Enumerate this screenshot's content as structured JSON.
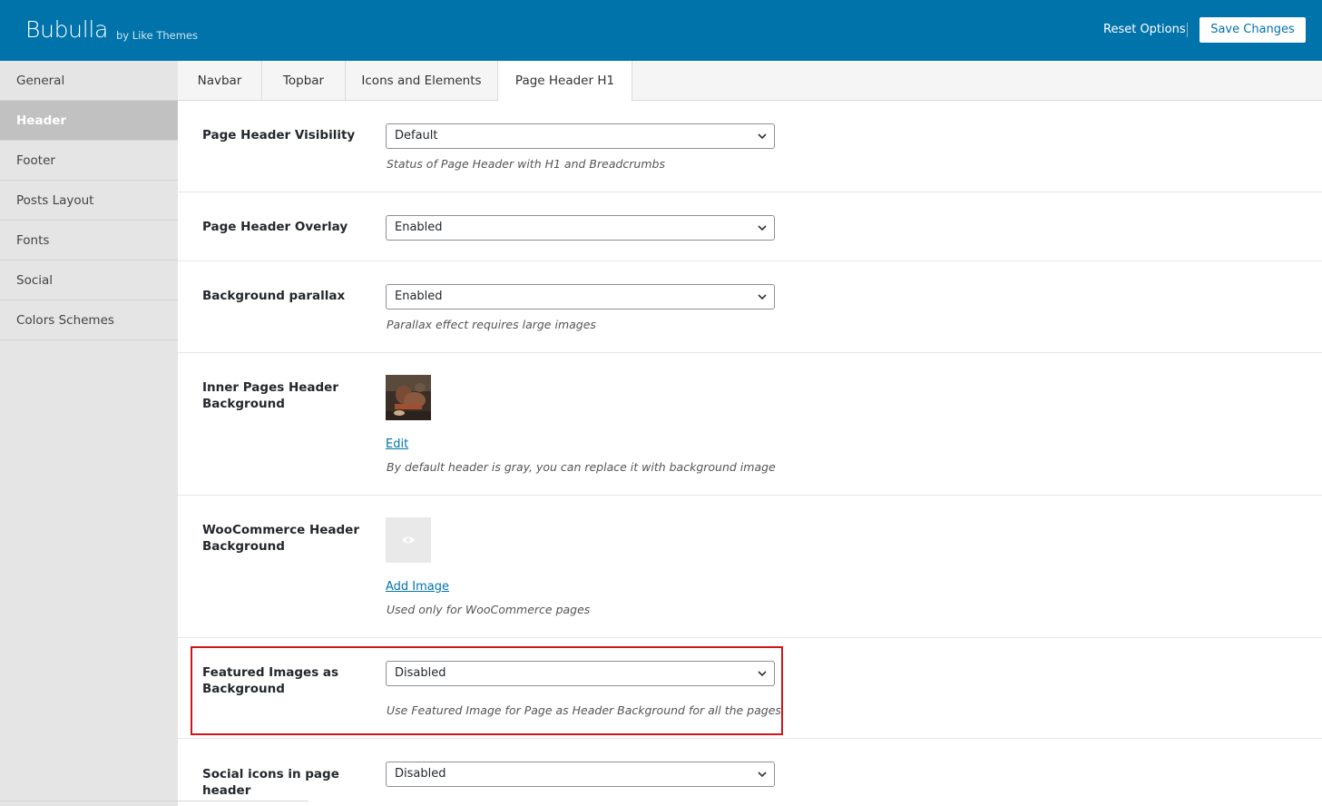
{
  "header": {
    "title": "Bubulla",
    "byline": "by Like Themes",
    "reset_label": "Reset Options",
    "save_label": "Save Changes"
  },
  "sidebar": {
    "items": [
      {
        "label": "General",
        "active": false
      },
      {
        "label": "Header",
        "active": true
      },
      {
        "label": "Footer",
        "active": false
      },
      {
        "label": "Posts Layout",
        "active": false
      },
      {
        "label": "Fonts",
        "active": false
      },
      {
        "label": "Social",
        "active": false
      },
      {
        "label": "Colors Schemes",
        "active": false
      }
    ]
  },
  "tabs": [
    {
      "label": "Navbar",
      "active": false
    },
    {
      "label": "Topbar",
      "active": false
    },
    {
      "label": "Icons and Elements",
      "active": false
    },
    {
      "label": "Page Header H1",
      "active": true
    }
  ],
  "fields": {
    "visibility": {
      "label": "Page Header Visibility",
      "value": "Default",
      "description": "Status of Page Header with H1 and Breadcrumbs"
    },
    "overlay": {
      "label": "Page Header Overlay",
      "value": "Enabled"
    },
    "parallax": {
      "label": "Background parallax",
      "value": "Enabled",
      "description": "Parallax effect requires large images"
    },
    "inner_bg": {
      "label": "Inner Pages Header Background",
      "link": "Edit",
      "description": "By default header is gray, you can replace it with background image"
    },
    "woo_bg": {
      "label": "WooCommerce Header Background",
      "link": "Add Image",
      "description": "Used only for WooCommerce pages"
    },
    "featured": {
      "label": "Featured Images as Background",
      "value": "Disabled",
      "description": "Use Featured Image for Page as Header Background for all the pages"
    },
    "social": {
      "label": "Social icons in page header",
      "value": "Disabled"
    }
  },
  "colors": {
    "brand": "#0073aa",
    "highlight": "#d0151a",
    "sidebar_active": "#c1c1c1"
  },
  "icons": {
    "chevron": "chevron-down-icon",
    "eye": "eye-icon"
  }
}
